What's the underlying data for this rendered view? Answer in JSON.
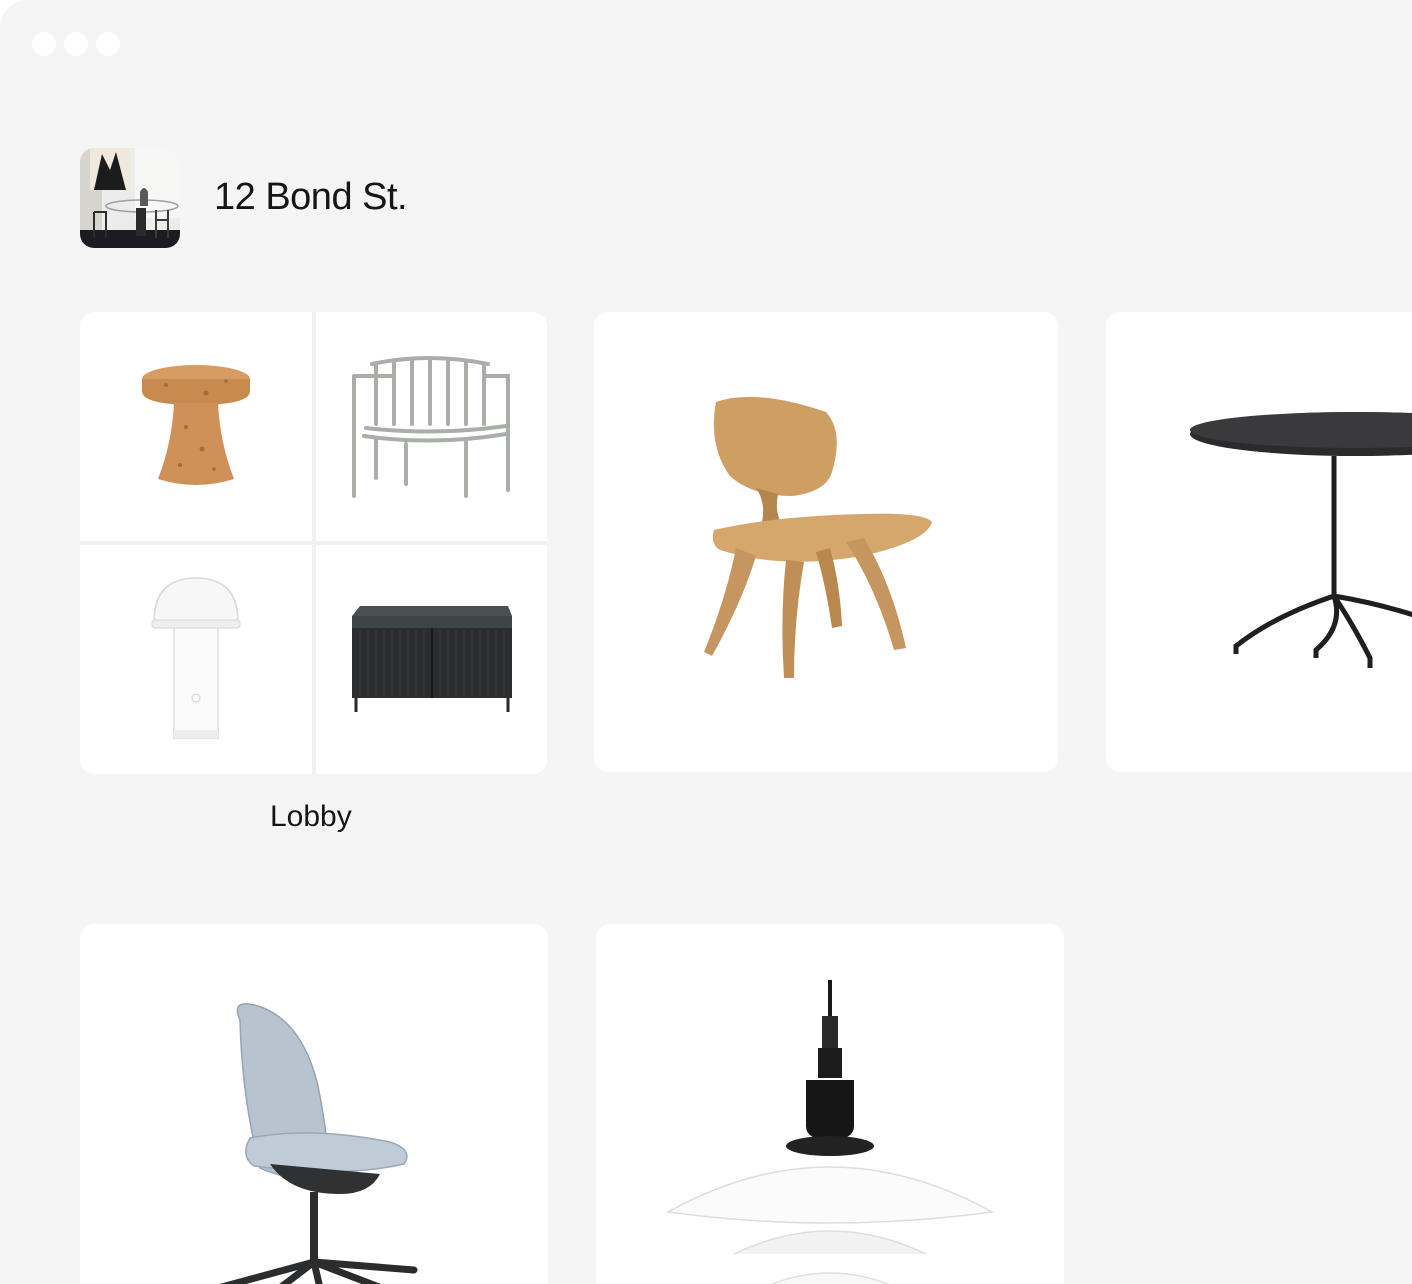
{
  "project": {
    "title": "12 Bond St.",
    "thumbnail_icon": "interior-room-photo"
  },
  "window_controls": [
    "close-dot",
    "minimize-dot",
    "zoom-dot"
  ],
  "collections": [
    {
      "label": "Lobby",
      "items": [
        "cork-stool-icon",
        "lounge-chair-icon",
        "table-lamp-icon",
        "sideboard-icon"
      ]
    }
  ],
  "products": [
    {
      "icon": "plywood-lounge-chair-icon"
    },
    {
      "icon": "round-bistro-table-icon"
    },
    {
      "icon": "office-task-chair-icon"
    },
    {
      "icon": "pendant-lamp-icon"
    }
  ],
  "colors": {
    "background": "#f5f5f5",
    "card": "#ffffff",
    "text": "#161616"
  }
}
